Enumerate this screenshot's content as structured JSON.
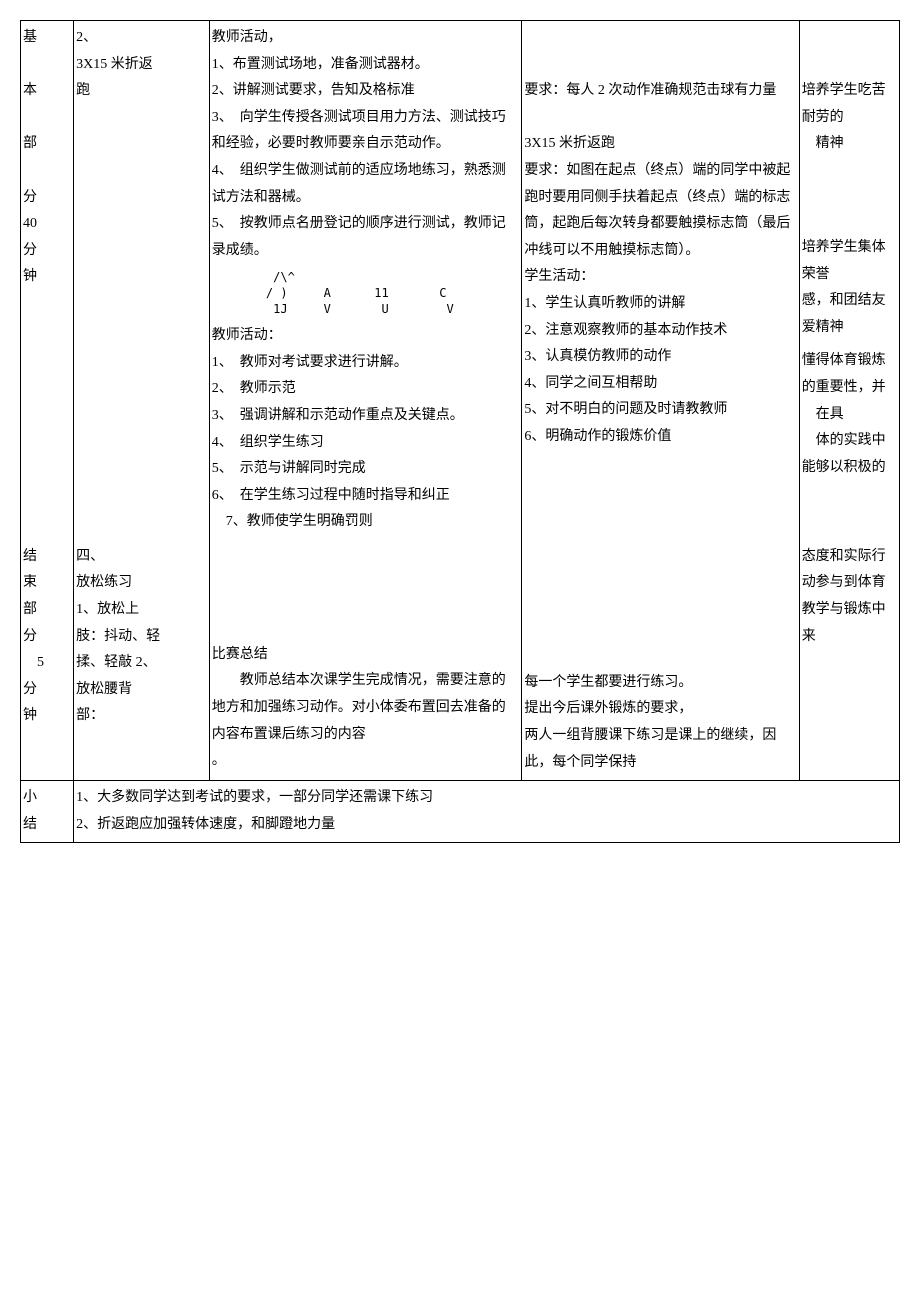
{
  "rows": {
    "main": {
      "stage": "基\n\n本\n\n部\n\n分\n40\n分\n钟",
      "item": "2、\n3X15 米折返\n跑",
      "teacher_top_header": "教师活动，",
      "teacher_top": "1、布置测试场地，准备测试器材。\n2、讲解测试要求，告知及格标准\n3、　向学生传授各测试项目用力方法、测试技巧和经验，必要时教师要亲自示范动作。\n4、　组织学生做测试前的适应场地练习，熟悉测试方法和器械。\n5、　按教师点名册登记的顺序进行测试，教师记录成绩。",
      "diagram": "      /\\^\n     / )     A      11       C\n      1J     V       U        V",
      "teacher_bottom_header": "教师活动：",
      "teacher_bottom": "1、　教师对考试要求进行讲解。\n2、　教师示范\n3、　强调讲解和示范动作重点及关键点。\n4、　组织学生练习\n5、　示范与讲解同时完成\n6、　在学生练习过程中随时指导和纠正\n　7、教师使学生明确罚则",
      "student_req1": "要求：每人 2 次动作准确规范击球有力量",
      "student_run_title": "3X15 米折返跑",
      "student_run_req": "要求：如图在起点（终点）端的同学中被起跑时要用同侧手扶着起点（终点）端的标志筒，起跑后每次转身都要触摸标志筒（最后冲线可以不用触摸标志筒）。",
      "student_act_header": "学生活动：",
      "student_acts": "1、学生认真听教师的讲解\n2、注意观察教师的基本动作技术\n3、认真模仿教师的动作\n4、同学之间互相帮助\n5、对不明白的问题及时请教教师\n6、明确动作的锻炼价值",
      "goal1": "培养学生吃苦\n耐劳的\n　精神",
      "goal2": "培养学生集体荣誉\n感，和团结友爱精神",
      "goal3": "懂得体育锻炼的重要性，并\n　在具\n　体的实践中能够以积极的"
    },
    "end": {
      "stage": "结\n束\n部\n分\n　5\n分\n钟",
      "item": "四、\n放松练习\n1、放松上\n肢：抖动、轻\n揉、轻敲 2、\n放松腰背\n部：",
      "summary_header": "比赛总结",
      "summary_body": "　　教师总结本次课学生完成情况，需要注意的地方和加强练习动作。对小体委布置回去准备的内容布置课后练习的内容\n。",
      "student": "每一个学生都要进行练习。\n提出今后课外锻炼的要求，\n两人一组背腰课下练习是课上的继续，因此，每个同学保持",
      "goal": "态度和实际行动参与到体育教学与锻炼中来"
    },
    "summary": {
      "label": "小\n结",
      "body": "1、大多数同学达到考试的要求，一部分同学还需课下练习\n2、折返跑应加强转体速度，和脚蹬地力量"
    }
  }
}
